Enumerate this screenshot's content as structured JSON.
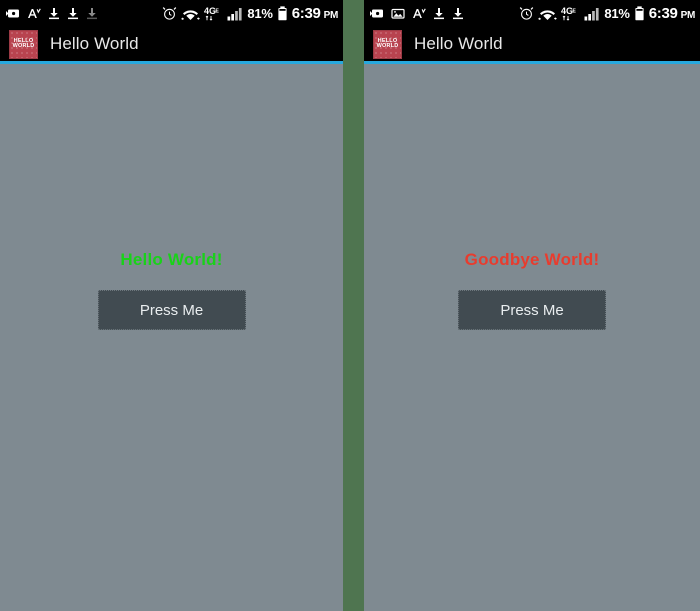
{
  "colors": {
    "status_bar_bg": "#000000",
    "action_bar_bg": "#000000",
    "accent_line": "#27a8dd",
    "content_bg": "#7f8a91",
    "divider_green": "#4f7550",
    "logo_red": "#b8434f",
    "button_bg": "#414b51",
    "hello_green": "#19d219",
    "goodbye_red": "#e83c2e"
  },
  "panels": [
    {
      "id": "left",
      "status_bar": {
        "icons_left": [
          "sd-card-icon",
          "font-size-icon",
          "download-icon",
          "download-icon",
          "download-faded-icon"
        ],
        "icons_right": [
          "alarm-clock-icon",
          "wifi-icon",
          "lte-4g-icon",
          "signal-bars-icon"
        ],
        "battery_percent": "81%",
        "battery_icon": "battery-icon",
        "time": "6:39",
        "ampm": "PM"
      },
      "action_bar": {
        "logo_line1": "HELLO",
        "logo_line2": "WORLD",
        "title": "Hello World"
      },
      "content": {
        "message": "Hello World!",
        "message_color": "#19d219",
        "button_label": "Press Me"
      }
    },
    {
      "id": "right",
      "status_bar": {
        "icons_left": [
          "sd-card-icon",
          "image-icon",
          "font-size-icon",
          "download-icon",
          "download-icon"
        ],
        "icons_right": [
          "alarm-clock-icon",
          "wifi-icon",
          "lte-4g-icon",
          "signal-bars-icon"
        ],
        "battery_percent": "81%",
        "battery_icon": "battery-icon",
        "time": "6:39",
        "ampm": "PM"
      },
      "action_bar": {
        "logo_line1": "HELLO",
        "logo_line2": "WORLD",
        "title": "Hello World"
      },
      "content": {
        "message": "Goodbye World!",
        "message_color": "#e83c2e",
        "button_label": "Press Me"
      }
    }
  ]
}
